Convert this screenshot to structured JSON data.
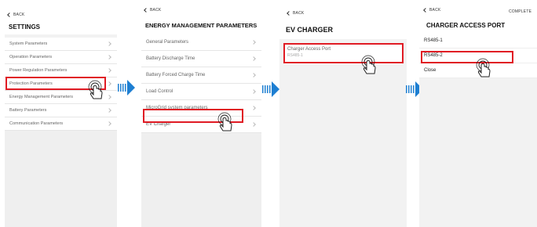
{
  "panel1": {
    "back_label": "BACK",
    "title": "SETTINGS",
    "items": [
      {
        "label": "System Parameters"
      },
      {
        "label": "Operation Parameters"
      },
      {
        "label": "Power Regulation Parameters"
      },
      {
        "label": "Protection Parameters"
      },
      {
        "label": "Energy Management Parameters"
      },
      {
        "label": "Battery Parameters"
      },
      {
        "label": "Communication Parameters"
      }
    ]
  },
  "panel2": {
    "back_label": "BACK",
    "title": "ENERGY MANAGEMENT PARAMETERS",
    "items": [
      {
        "label": "General Parameters"
      },
      {
        "label": "Battery Discharge Time"
      },
      {
        "label": "Battery Forced Charge Time"
      },
      {
        "label": "Load Control"
      },
      {
        "label": "MicroGrid system parameters"
      },
      {
        "label": "EV Charger"
      }
    ]
  },
  "panel3": {
    "back_label": "BACK",
    "title": "EV CHARGER",
    "item": {
      "label": "Charger Access Port",
      "value": "RS485-1"
    }
  },
  "panel4": {
    "back_label": "BACK",
    "complete_label": "COMPLETE",
    "title": "CHARGER ACCESS PORT",
    "options": [
      {
        "label": "RS485-1"
      },
      {
        "label": "RS485-2"
      },
      {
        "label": "Close"
      }
    ]
  },
  "colors": {
    "highlight": "#e01b24",
    "arrow": "#1e7fd2",
    "panel_bg": "#f2f2f2"
  },
  "icons": [
    "chevron-left-icon",
    "chevron-right-icon",
    "tap-hand-icon",
    "next-arrow-icon"
  ]
}
